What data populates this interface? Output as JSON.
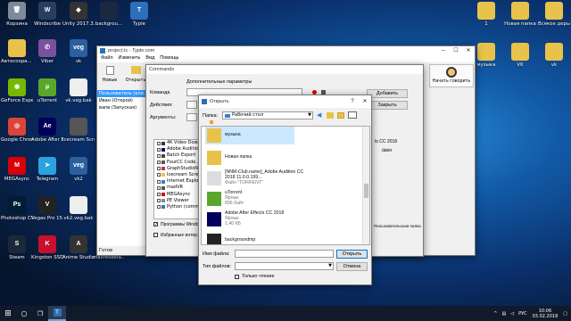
{
  "desktop": {
    "left_icons": [
      {
        "label": "Корзина",
        "color": "#7d8a99",
        "glyph": "🗑"
      },
      {
        "label": "Windscribe",
        "color": "#2a3f5f",
        "glyph": "W"
      },
      {
        "label": "Unity 2017.3.0f3",
        "color": "#333",
        "glyph": "◆"
      },
      {
        "label": "backgrou...",
        "color": "#1b2940",
        "glyph": ""
      },
      {
        "label": "Typle",
        "color": "#2d6fb8",
        "glyph": "T"
      },
      {
        "label": "Автосохра... Adobe After...",
        "color": "#e8c24a",
        "glyph": ""
      },
      {
        "label": "Viber",
        "color": "#7b519d",
        "glyph": "✆"
      },
      {
        "label": "vk",
        "color": "#2c5f9e",
        "glyph": "veg"
      },
      {
        "label": "GeForce Experience",
        "color": "#76b900",
        "glyph": "◉"
      },
      {
        "label": "uTorrent",
        "color": "#5aa62b",
        "glyph": "µ"
      },
      {
        "label": "vk.veg.bak",
        "color": "#eee",
        "glyph": ""
      },
      {
        "label": "Google Chrome",
        "color": "#db4437",
        "glyph": "◎"
      },
      {
        "label": "Adobe After Effects CC...",
        "color": "#00005b",
        "glyph": "Ae"
      },
      {
        "label": "Icecream Screen Rec...",
        "color": "#555",
        "glyph": ""
      },
      {
        "label": "MEGAsync",
        "color": "#d90007",
        "glyph": "M"
      },
      {
        "label": "Telegram",
        "color": "#2aa3de",
        "glyph": "➤"
      },
      {
        "label": "vk2",
        "color": "#2c5f9e",
        "glyph": "veg"
      },
      {
        "label": "Photoshop CS6 x64",
        "color": "#001d34",
        "glyph": "Ps"
      },
      {
        "label": "Vegas Pro 15.0 (64-bit)",
        "color": "#222",
        "glyph": "V"
      },
      {
        "label": "vk2.veg.bak",
        "color": "#eee",
        "glyph": ""
      },
      {
        "label": "Steam",
        "color": "#1b2838",
        "glyph": "S"
      },
      {
        "label": "Kingston SSD Manager",
        "color": "#c8102e",
        "glyph": "K"
      },
      {
        "label": "Anime Studio Pro",
        "color": "#333",
        "glyph": "A"
      },
      {
        "label": "maxresdefa...",
        "color": "#444",
        "glyph": ""
      }
    ],
    "right_icons": [
      {
        "label": "1",
        "color": "#e8c24a",
        "glyph": ""
      },
      {
        "label": "Новая папка",
        "color": "#e8c24a",
        "glyph": ""
      },
      {
        "label": "Всякое дерьмо",
        "color": "#e8c24a",
        "glyph": ""
      },
      {
        "label": "музыка",
        "color": "#e8c24a",
        "glyph": ""
      },
      {
        "label": "VK",
        "color": "#e8c24a",
        "glyph": ""
      },
      {
        "label": "vk",
        "color": "#e8c24a",
        "glyph": ""
      }
    ]
  },
  "typle_window": {
    "title": "project.tc - Typle.com",
    "menu": [
      "Файл",
      "Изменить",
      "Вид",
      "Помощь"
    ],
    "toolbar": {
      "new": "Новые",
      "open": "Открыть",
      "start_talk": "Начать говорить"
    },
    "list_items": [
      "Пользователь (кли...",
      "Иван (Открой)",
      "вапв (Запуская)"
    ],
    "status": "Готов"
  },
  "commands_dialog": {
    "title": "Commands",
    "extra_params": "Дополнительные параметры",
    "command_label": "Команда",
    "action_label": "Действия:",
    "args_label": "Аргументы:",
    "add_button": "Добавить",
    "close_button": "Закрыть",
    "programs_list": [
      "4K Video Dow...",
      "Adobe Audition...",
      "Batch Export",
      "FourCC Code...",
      "GraphStudioN...",
      "Icecream Scre...",
      "Internet Explor...",
      "madVR",
      "MEGAsync",
      "PE Viewer",
      "Python (comma..."
    ],
    "right_partial_1": "ts CC 2018",
    "right_partial_2": "dater",
    "programs_checkbox": "Программы Windows",
    "favorites_checkbox": "Избранные интер...",
    "user_folder": "Пользовательская папка"
  },
  "open_dialog": {
    "title": "Открыть",
    "folder_label": "Папка:",
    "folder_value": "Рабочий стол",
    "files": [
      {
        "name": "музыка",
        "sub": "",
        "type": "folder"
      },
      {
        "name": "Новая папка",
        "sub": "",
        "type": "folder"
      },
      {
        "name": "[NNM-Club.name]_Adobe Audition CC 2018 11.0.0.199...",
        "sub": "Файл \"TORRENT\"",
        "type": "torrent"
      },
      {
        "name": "uTorrent",
        "sub": "Ярлык",
        "sub2": "896 байт",
        "type": "utorrent"
      },
      {
        "name": "Adobe After Effects CC 2018",
        "sub": "Ярлык",
        "sub2": "1,40 КБ",
        "type": "ae"
      },
      {
        "name": "backgroundmp",
        "sub": "",
        "type": "video"
      }
    ],
    "filename_label": "Имя файла:",
    "filetype_label": "Тип файлов:",
    "open_button": "Открыть",
    "cancel_button": "Отмена",
    "readonly_label": "Только чтение"
  },
  "taskbar": {
    "lang": "РУС",
    "time": "10:06",
    "date": "03.02.2018"
  }
}
